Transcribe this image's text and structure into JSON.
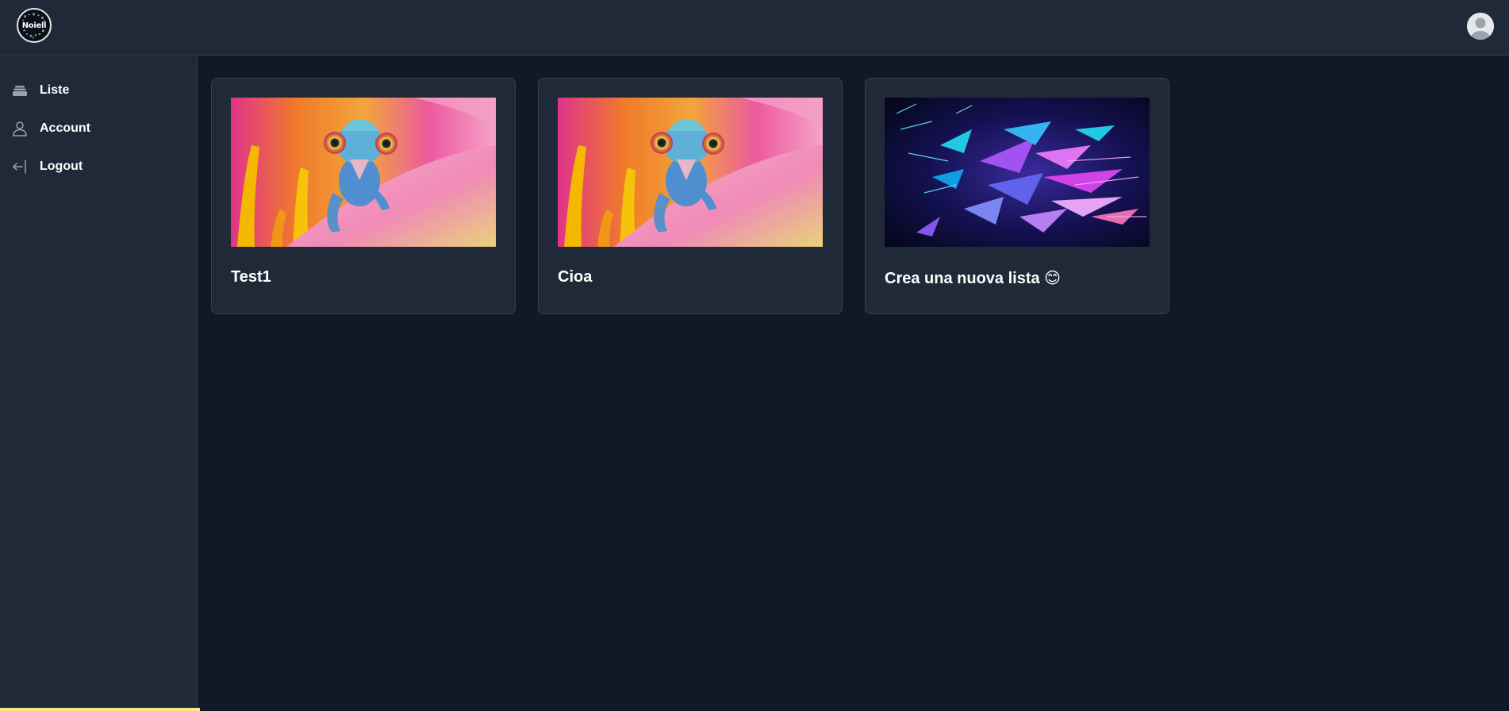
{
  "header": {
    "logo_text": "Noiell",
    "logo_icon": "app-logo",
    "avatar_icon": "user-avatar-icon"
  },
  "sidebar": {
    "items": [
      {
        "label": "Liste",
        "icon": "stack-icon"
      },
      {
        "label": "Account",
        "icon": "user-icon"
      },
      {
        "label": "Logout",
        "icon": "logout-icon"
      }
    ]
  },
  "cards": [
    {
      "title": "Test1",
      "image": "chameleon-on-flower"
    },
    {
      "title": "Cioa",
      "image": "chameleon-on-flower"
    },
    {
      "title": "Crea una nuova lista 😊",
      "image": "abstract-shattered-neon"
    }
  ],
  "colors": {
    "background": "#111827",
    "panel": "#1f2937",
    "border": "#374151",
    "text": "#ffffff",
    "bottom_bar": "#fde68a"
  }
}
